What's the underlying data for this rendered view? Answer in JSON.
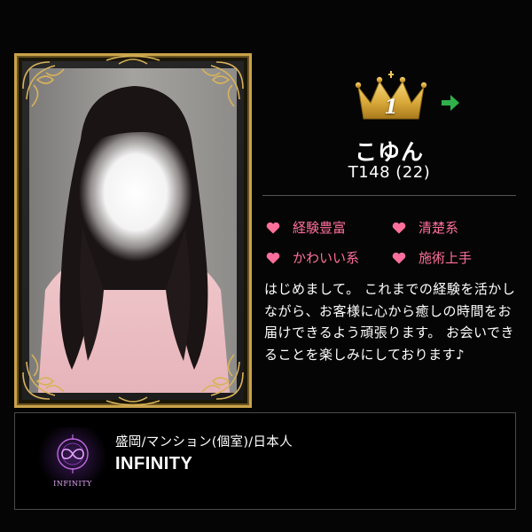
{
  "profile": {
    "rank": "1",
    "name": "こゆん",
    "stats": "T148 (22)",
    "tags": [
      {
        "label": "経験豊富"
      },
      {
        "label": "清楚系"
      },
      {
        "label": "かわいい系"
      },
      {
        "label": "施術上手"
      }
    ],
    "description": "はじめまして。 これまでの経験を活かしながら、お客様に心から癒しの時間をお届けできるよう頑張ります。 お会いできることを楽しみにしております♪"
  },
  "shop": {
    "meta": "盛岡/マンション(個室)/日本人",
    "name": "INFINITY",
    "logo_text": "INFINITY"
  },
  "colors": {
    "background": "#050505",
    "gold": "#c9a24a",
    "tag_pink": "#ff6f9c",
    "arrow_green": "#2fb04a",
    "logo_purple": "#b45cd8"
  },
  "icons": {
    "rank": "crown-icon",
    "next": "arrow-right-icon",
    "tag": "heart-icon"
  }
}
